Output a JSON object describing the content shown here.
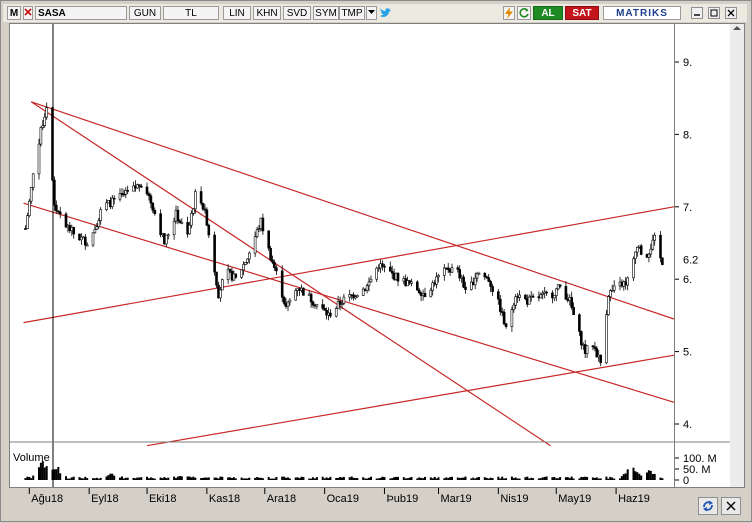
{
  "toolbar": {
    "m_label": "M",
    "symbol": "SASA",
    "period": "GUN",
    "currency": "TL",
    "scale": "LIN",
    "khn": "KHN",
    "svd": "SVD",
    "sym": "SYM",
    "tmp": "TMP",
    "buy_label": "AL",
    "sell_label": "SAT",
    "brand": "MATRIKS",
    "colors": {
      "buy": "#1f8a24",
      "sell": "#c4141b",
      "brand": "#1d3f8f"
    },
    "icons": [
      "dropdown-arrow-icon",
      "twitter-bird-icon",
      "lightning-icon",
      "refresh-icon",
      "minimize-icon",
      "restore-icon",
      "close-icon"
    ]
  },
  "chart_data": {
    "type": "candlestick",
    "symbol": "SASA",
    "price_axis": {
      "ticks": [
        "9.",
        "8.",
        "7.",
        "6.",
        "5.",
        "4."
      ],
      "tick_values": [
        9,
        8,
        7,
        6,
        5,
        4
      ],
      "last_value_label": "6.2",
      "last_value": 6.2,
      "range": [
        3.7,
        9.5
      ]
    },
    "volume_axis": {
      "label": "Volume",
      "ticks": [
        "100. M",
        "50. M",
        "0"
      ],
      "tick_values": [
        100,
        50,
        0
      ],
      "unit": "M"
    },
    "x_axis": {
      "labels": [
        "Ağu18",
        "Eyl18",
        "Eki18",
        "Kas18",
        "Ara18",
        "Oca19",
        "Þub19",
        "Mar19",
        "Nis19",
        "May19",
        "Haz19"
      ]
    },
    "colors": {
      "candles": "#000000",
      "trendlines": "#c82828",
      "volume": "#000000"
    },
    "grid": false,
    "price_path": [
      [
        "2018-07-30",
        6.7
      ],
      [
        "2018-08-05",
        7.8
      ],
      [
        "2018-08-10",
        8.4
      ],
      [
        "2018-08-14",
        7.0
      ],
      [
        "2018-08-18",
        6.8
      ],
      [
        "2018-08-25",
        6.6
      ],
      [
        "2018-09-01",
        6.5
      ],
      [
        "2018-09-08",
        7.0
      ],
      [
        "2018-09-15",
        7.1
      ],
      [
        "2018-09-22",
        7.2
      ],
      [
        "2018-09-29",
        7.35
      ],
      [
        "2018-10-04",
        7.0
      ],
      [
        "2018-10-10",
        6.5
      ],
      [
        "2018-10-16",
        6.9
      ],
      [
        "2018-10-22",
        6.6
      ],
      [
        "2018-10-27",
        7.3
      ],
      [
        "2018-11-01",
        6.8
      ],
      [
        "2018-11-07",
        5.8
      ],
      [
        "2018-11-11",
        6.1
      ],
      [
        "2018-11-16",
        6.0
      ],
      [
        "2018-11-22",
        6.3
      ],
      [
        "2018-11-29",
        6.8
      ],
      [
        "2018-12-03",
        6.4
      ],
      [
        "2018-12-08",
        6.0
      ],
      [
        "2018-12-12",
        5.6
      ],
      [
        "2018-12-18",
        5.9
      ],
      [
        "2018-12-26",
        5.7
      ],
      [
        "2019-01-03",
        5.5
      ],
      [
        "2019-01-10",
        5.7
      ],
      [
        "2019-01-17",
        5.8
      ],
      [
        "2019-01-23",
        5.9
      ],
      [
        "2019-01-29",
        6.2
      ],
      [
        "2019-02-03",
        6.1
      ],
      [
        "2019-02-09",
        6.0
      ],
      [
        "2019-02-16",
        5.9
      ],
      [
        "2019-02-22",
        5.8
      ],
      [
        "2019-02-28",
        6.0
      ],
      [
        "2019-03-06",
        6.15
      ],
      [
        "2019-03-11",
        6.1
      ],
      [
        "2019-03-16",
        5.8
      ],
      [
        "2019-03-21",
        6.1
      ],
      [
        "2019-03-27",
        6.0
      ],
      [
        "2019-04-02",
        5.6
      ],
      [
        "2019-04-05",
        5.3
      ],
      [
        "2019-04-10",
        5.8
      ],
      [
        "2019-04-16",
        5.7
      ],
      [
        "2019-04-22",
        5.75
      ],
      [
        "2019-04-29",
        5.8
      ],
      [
        "2019-05-03",
        5.9
      ],
      [
        "2019-05-08",
        5.7
      ],
      [
        "2019-05-12",
        5.3
      ],
      [
        "2019-05-16",
        5.0
      ],
      [
        "2019-05-20",
        5.1
      ],
      [
        "2019-05-24",
        4.85
      ],
      [
        "2019-05-28",
        5.8
      ],
      [
        "2019-06-02",
        5.9
      ],
      [
        "2019-06-08",
        6.0
      ],
      [
        "2019-06-12",
        6.5
      ],
      [
        "2019-06-16",
        6.3
      ],
      [
        "2019-06-21",
        6.55
      ],
      [
        "2019-06-25",
        6.2
      ]
    ],
    "trendlines": [
      {
        "from": [
          "2018-08-02",
          8.45
        ],
        "to": [
          "2019-07-01",
          5.45
        ]
      },
      {
        "from": [
          "2018-08-02",
          8.45
        ],
        "to": [
          "2019-04-28",
          3.7
        ]
      },
      {
        "from": [
          "2018-07-29",
          7.05
        ],
        "to": [
          "2019-07-01",
          4.3
        ]
      },
      {
        "from": [
          "2018-07-29",
          5.4
        ],
        "to": [
          "2019-07-01",
          7.0
        ]
      },
      {
        "from": [
          "2018-10-01",
          3.7
        ],
        "to": [
          "2019-07-01",
          4.95
        ]
      }
    ],
    "volume_peaks": [
      [
        "2018-08-08",
        105
      ],
      [
        "2018-08-12",
        88
      ],
      [
        "2018-08-15",
        70
      ],
      [
        "2018-09-12",
        35
      ],
      [
        "2018-10-20",
        30
      ],
      [
        "2019-03-11",
        12
      ],
      [
        "2019-06-09",
        70
      ],
      [
        "2019-06-18",
        55
      ]
    ]
  }
}
